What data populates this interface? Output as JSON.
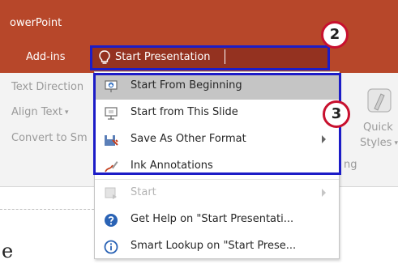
{
  "window": {
    "app_title": "owerPoint"
  },
  "ribbon_tabs": {
    "addins": "Add-ins"
  },
  "tell_me": {
    "icon": "lightbulb-icon",
    "value": "Start Presentation"
  },
  "ribbon": {
    "text_direction": "Text Direction",
    "align_text": "Align Text",
    "convert_to_smartart": "Convert to Sm",
    "quick_styles_line1": "Quick",
    "quick_styles_line2": "Styles",
    "group_fragment": "ng"
  },
  "document": {
    "fragment": "e"
  },
  "menu": {
    "items": [
      {
        "label": "Start From Beginning",
        "icon": "slideshow-from-beginning-icon",
        "highlighted": true
      },
      {
        "label": "Start from This Slide",
        "icon": "slideshow-from-current-icon"
      },
      {
        "label": "Save As Other Format",
        "icon": "save-as-format-icon",
        "submenu": true
      },
      {
        "label": "Ink Annotations",
        "icon": "ink-pen-icon"
      },
      {
        "label": "Start",
        "icon": "start-icon",
        "submenu": true,
        "disabled": true
      },
      {
        "label": "Get Help on \"Start Presentati...",
        "icon": "help-icon"
      },
      {
        "label": "Smart Lookup on \"Start Prese...",
        "icon": "smart-lookup-icon"
      }
    ]
  },
  "badges": {
    "step_search": "2",
    "step_menu": "3"
  },
  "colors": {
    "ribbon_accent": "#b7472a",
    "highlight_box": "#1c1cc7",
    "badge_ring": "#c8102e",
    "menu_highlight": "#c5c5c5"
  }
}
